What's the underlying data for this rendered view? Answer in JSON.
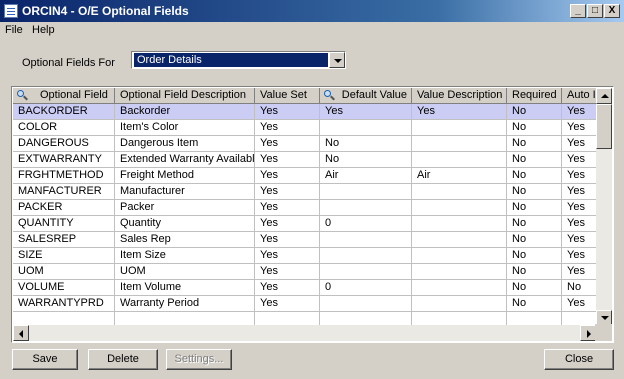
{
  "window": {
    "title": "ORCIN4 - O/E Optional Fields",
    "controls": {
      "minimize": "_",
      "maximize": "□",
      "close": "X"
    }
  },
  "menu": [
    "File",
    "Help"
  ],
  "filter": {
    "label": "Optional Fields For",
    "selected": "Order Details"
  },
  "grid": {
    "columns": [
      {
        "label": "Optional Field",
        "finder_icon": "magnifier-icon"
      },
      {
        "label": "Optional Field Description"
      },
      {
        "label": "Value Set"
      },
      {
        "label": "Default Value",
        "finder_icon": "magnifier-icon"
      },
      {
        "label": "Value Description"
      },
      {
        "label": "Required"
      },
      {
        "label": "Auto In"
      }
    ],
    "rows": [
      [
        "BACKORDER",
        "Backorder",
        "Yes",
        "Yes",
        "Yes",
        "No",
        "Yes"
      ],
      [
        "COLOR",
        "Item's Color",
        "Yes",
        "",
        "",
        "No",
        "Yes"
      ],
      [
        "DANGEROUS",
        "Dangerous Item",
        "Yes",
        "No",
        "",
        "No",
        "Yes"
      ],
      [
        "EXTWARRANTY",
        "Extended Warranty Available",
        "Yes",
        "No",
        "",
        "No",
        "Yes"
      ],
      [
        "FRGHTMETHOD",
        "Freight Method",
        "Yes",
        "Air",
        "Air",
        "No",
        "Yes"
      ],
      [
        "MANFACTURER",
        "Manufacturer",
        "Yes",
        "",
        "",
        "No",
        "Yes"
      ],
      [
        "PACKER",
        "Packer",
        "Yes",
        "",
        "",
        "No",
        "Yes"
      ],
      [
        "QUANTITY",
        "Quantity",
        "Yes",
        "0",
        "",
        "No",
        "Yes"
      ],
      [
        "SALESREP",
        "Sales Rep",
        "Yes",
        "",
        "",
        "No",
        "Yes"
      ],
      [
        "SIZE",
        "Item Size",
        "Yes",
        "",
        "",
        "No",
        "Yes"
      ],
      [
        "UOM",
        "UOM",
        "Yes",
        "",
        "",
        "No",
        "Yes"
      ],
      [
        "VOLUME",
        "Item Volume",
        "Yes",
        "0",
        "",
        "No",
        "No"
      ],
      [
        "WARRANTYPRD",
        "Warranty Period",
        "Yes",
        "",
        "",
        "No",
        "Yes"
      ],
      [
        "",
        "",
        "",
        "",
        "",
        "",
        ""
      ]
    ],
    "selected_row": 0
  },
  "buttons": {
    "save": "Save",
    "delete": "Delete",
    "settings": "Settings...",
    "close": "Close"
  },
  "colors": {
    "title_bar": "#0a246a",
    "selected_row": "#cccdf4",
    "combo_highlight": "#0a246a"
  }
}
